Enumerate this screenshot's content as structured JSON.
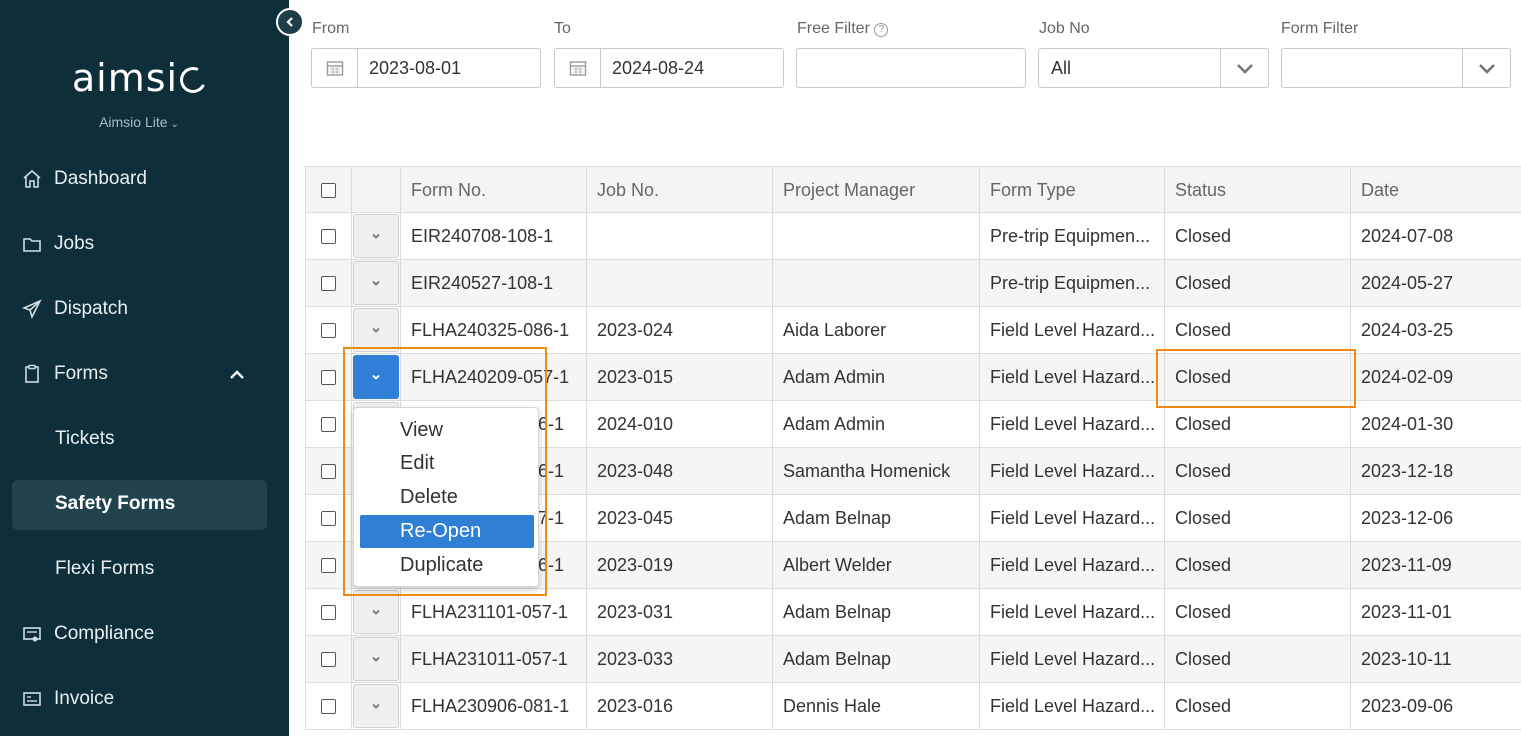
{
  "app": {
    "logo_text": "aimsio",
    "plan_label": "Aimsio Lite"
  },
  "sidebar": {
    "items": [
      {
        "label": "Dashboard",
        "icon": "home-icon"
      },
      {
        "label": "Jobs",
        "icon": "folder-icon"
      },
      {
        "label": "Dispatch",
        "icon": "paper-plane-icon"
      },
      {
        "label": "Forms",
        "icon": "clipboard-icon",
        "expanded": true
      },
      {
        "label": "Compliance",
        "icon": "certificate-icon"
      },
      {
        "label": "Invoice",
        "icon": "invoice-icon"
      }
    ],
    "sub_items": [
      {
        "label": "Tickets"
      },
      {
        "label": "Safety Forms",
        "active": true
      },
      {
        "label": "Flexi Forms"
      }
    ]
  },
  "filters": {
    "from_label": "From",
    "from_value": "2023-08-01",
    "to_label": "To",
    "to_value": "2024-08-24",
    "free_filter_label": "Free Filter",
    "free_filter_value": "",
    "job_no_label": "Job No",
    "job_no_value": "All",
    "form_filter_label": "Form Filter",
    "form_filter_value": ""
  },
  "table": {
    "headers": [
      "Form No.",
      "Job No.",
      "Project Manager",
      "Form Type",
      "Status",
      "Date"
    ],
    "rows": [
      {
        "form_no": "EIR240708-108-1",
        "job_no": "",
        "pm": "",
        "form_type": "Pre-trip Equipmen...",
        "status": "Closed",
        "date": "2024-07-08"
      },
      {
        "form_no": "EIR240527-108-1",
        "job_no": "",
        "pm": "",
        "form_type": "Pre-trip Equipmen...",
        "status": "Closed",
        "date": "2024-05-27"
      },
      {
        "form_no": "FLHA240325-086-1",
        "job_no": "2023-024",
        "pm": "Aida Laborer",
        "form_type": "Field Level Hazard...",
        "status": "Closed",
        "date": "2024-03-25"
      },
      {
        "form_no": "FLHA240209-057-1",
        "job_no": "2023-015",
        "pm": "Adam Admin",
        "form_type": "Field Level Hazard...",
        "status": "Closed",
        "date": "2024-02-09"
      },
      {
        "form_no": "6-1",
        "job_no": "2024-010",
        "pm": "Adam Admin",
        "form_type": "Field Level Hazard...",
        "status": "Closed",
        "date": "2024-01-30"
      },
      {
        "form_no": "6-1",
        "job_no": "2023-048",
        "pm": "Samantha Homenick",
        "form_type": "Field Level Hazard...",
        "status": "Closed",
        "date": "2023-12-18"
      },
      {
        "form_no": "7-1",
        "job_no": "2023-045",
        "pm": "Adam Belnap",
        "form_type": "Field Level Hazard...",
        "status": "Closed",
        "date": "2023-12-06"
      },
      {
        "form_no": "6-1",
        "job_no": "2023-019",
        "pm": "Albert Welder",
        "form_type": "Field Level Hazard...",
        "status": "Closed",
        "date": "2023-11-09"
      },
      {
        "form_no": "FLHA231101-057-1",
        "job_no": "2023-031",
        "pm": "Adam Belnap",
        "form_type": "Field Level Hazard...",
        "status": "Closed",
        "date": "2023-11-01"
      },
      {
        "form_no": "FLHA231011-057-1",
        "job_no": "2023-033",
        "pm": "Adam Belnap",
        "form_type": "Field Level Hazard...",
        "status": "Closed",
        "date": "2023-10-11"
      },
      {
        "form_no": "FLHA230906-081-1",
        "job_no": "2023-016",
        "pm": "Dennis Hale",
        "form_type": "Field Level Hazard...",
        "status": "Closed",
        "date": "2023-09-06"
      }
    ]
  },
  "row_menu": {
    "items": [
      "View",
      "Edit",
      "Delete",
      "Re-Open",
      "Duplicate"
    ],
    "selected": "Re-Open"
  },
  "colors": {
    "sidebar_bg": "#0e2f3a",
    "accent_blue": "#2f7fd4",
    "highlight_orange": "#f08a12"
  }
}
